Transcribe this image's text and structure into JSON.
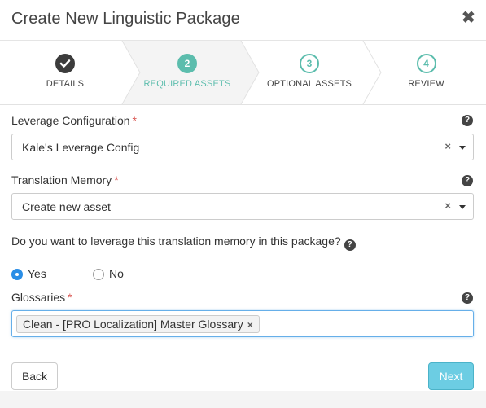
{
  "modal": {
    "title": "Create New Linguistic Package",
    "close_glyph": "✖"
  },
  "wizard": {
    "steps": [
      {
        "number": "✓",
        "label": "DETAILS",
        "state": "complete"
      },
      {
        "number": "2",
        "label": "REQUIRED ASSETS",
        "state": "active"
      },
      {
        "number": "3",
        "label": "OPTIONAL ASSETS",
        "state": "upcoming"
      },
      {
        "number": "4",
        "label": "REVIEW",
        "state": "upcoming"
      }
    ]
  },
  "form": {
    "required_mark": "*",
    "help_glyph": "?",
    "leverage": {
      "label": "Leverage Configuration",
      "value": "Kale's Leverage Config"
    },
    "memory": {
      "label": "Translation Memory",
      "value": "Create new asset"
    },
    "clear_glyph": "×",
    "question": "Do you want to leverage this translation memory in this package?",
    "options": {
      "yes": "Yes",
      "no": "No",
      "selected": "Yes"
    },
    "glossaries": {
      "label": "Glossaries",
      "tags": [
        "Clean - [PRO Localization] Master Glossary"
      ],
      "tag_remove_glyph": "×"
    }
  },
  "footer": {
    "back_label": "Back",
    "next_label": "Next"
  },
  "colors": {
    "accent": "#5cbdad",
    "primary_button": "#6ccde3",
    "required": "#d9534f",
    "radio_selected": "#2a8ee6"
  }
}
